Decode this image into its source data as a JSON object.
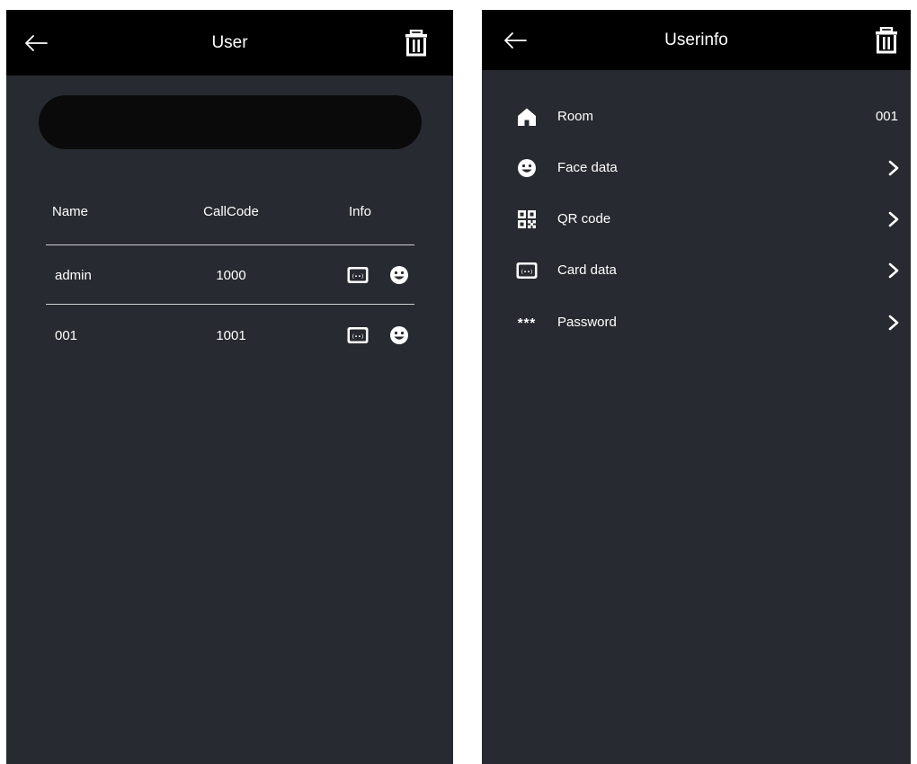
{
  "user_screen": {
    "title": "User",
    "search": {
      "value": "",
      "placeholder": ""
    },
    "columns": {
      "name": "Name",
      "callcode": "CallCode",
      "info": "Info"
    },
    "rows": [
      {
        "name": "admin",
        "callcode": "1000",
        "info_icons": [
          "card-icon",
          "face-icon"
        ]
      },
      {
        "name": "001",
        "callcode": "1001",
        "info_icons": [
          "card-icon",
          "face-icon"
        ]
      }
    ],
    "icons": {
      "back": "back-arrow-icon",
      "delete": "trash-icon"
    }
  },
  "userinfo_screen": {
    "title": "Userinfo",
    "items": [
      {
        "icon": "home-icon",
        "label": "Room",
        "value": "001"
      },
      {
        "icon": "face-icon",
        "label": "Face data",
        "value": ""
      },
      {
        "icon": "qr-code-icon",
        "label": "QR code",
        "value": ""
      },
      {
        "icon": "card-icon",
        "label": "Card data",
        "value": ""
      },
      {
        "icon": "password-icon",
        "label": "Password",
        "value": "",
        "icon_text": "***"
      }
    ],
    "icons": {
      "back": "back-arrow-icon",
      "delete": "trash-icon",
      "chevron": "chevron-right-icon"
    }
  },
  "colors": {
    "panel_bg": "#272a30",
    "topbar_bg": "#000000",
    "search_bg": "#0a0a0a",
    "text": "#ffffff",
    "divider": "#cfd0d2"
  }
}
